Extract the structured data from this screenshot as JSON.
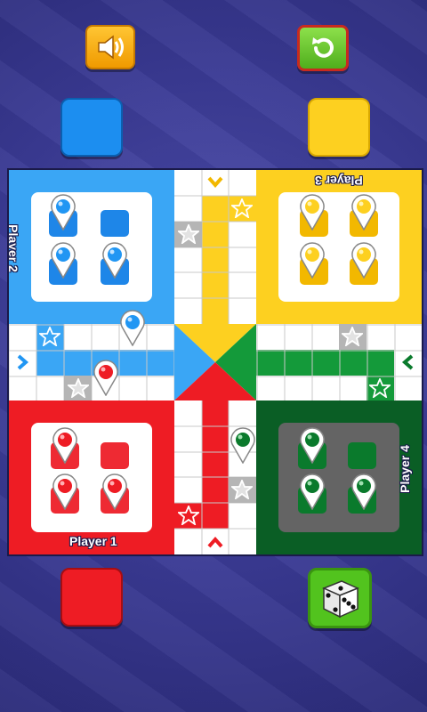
{
  "controls": {
    "sound_icon": "speaker-icon",
    "restart_icon": "restart-icon",
    "dice_icon": "dice-icon"
  },
  "colors": {
    "blue": "#2196f3",
    "yellow": "#fdd020",
    "red": "#ee1c24",
    "green": "#0a6b2a"
  },
  "board": {
    "players": [
      {
        "name": "Player 1",
        "color": "red",
        "position": "bottom-left",
        "pawns_home": 3,
        "pawns_on_board": 1
      },
      {
        "name": "Player 2",
        "color": "blue",
        "position": "top-left",
        "pawns_home": 3,
        "pawns_on_board": 1
      },
      {
        "name": "Player 3",
        "color": "yellow",
        "position": "top-right",
        "pawns_home": 4,
        "pawns_on_board": 0
      },
      {
        "name": "Player 4",
        "color": "green",
        "position": "bottom-right",
        "pawns_home": 3,
        "pawns_on_board": 1
      }
    ]
  }
}
